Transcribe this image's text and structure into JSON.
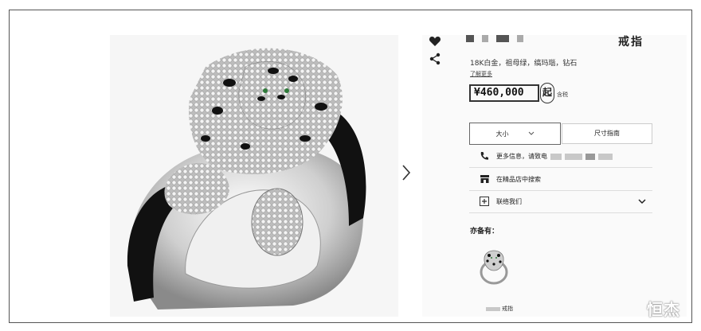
{
  "gallery": {
    "alt_icon": "panther-ring-image",
    "next_icon": "chevron-right-icon"
  },
  "sidebar_icons": [
    "heart-icon",
    "share-icon"
  ],
  "product": {
    "title": "戒指",
    "materials": "18K白金，祖母绿，缟玛瑙，钻石",
    "learn_more": "了解更多",
    "price": "¥460,000",
    "price_suffix": "起",
    "tax": "含税"
  },
  "size": {
    "select_label": "大小",
    "guide_label": "尺寸指南"
  },
  "contact": {
    "phone_text": "更多信息，请致电",
    "store_text": "在精品店中搜索",
    "contact_text": "联络我们"
  },
  "also": {
    "heading": "亦备有：",
    "item_label": "戒指"
  },
  "watermark": "恒杰",
  "colors": {
    "onyx": "#111111",
    "metal": "#d9d9d9",
    "accent": "#222222"
  }
}
